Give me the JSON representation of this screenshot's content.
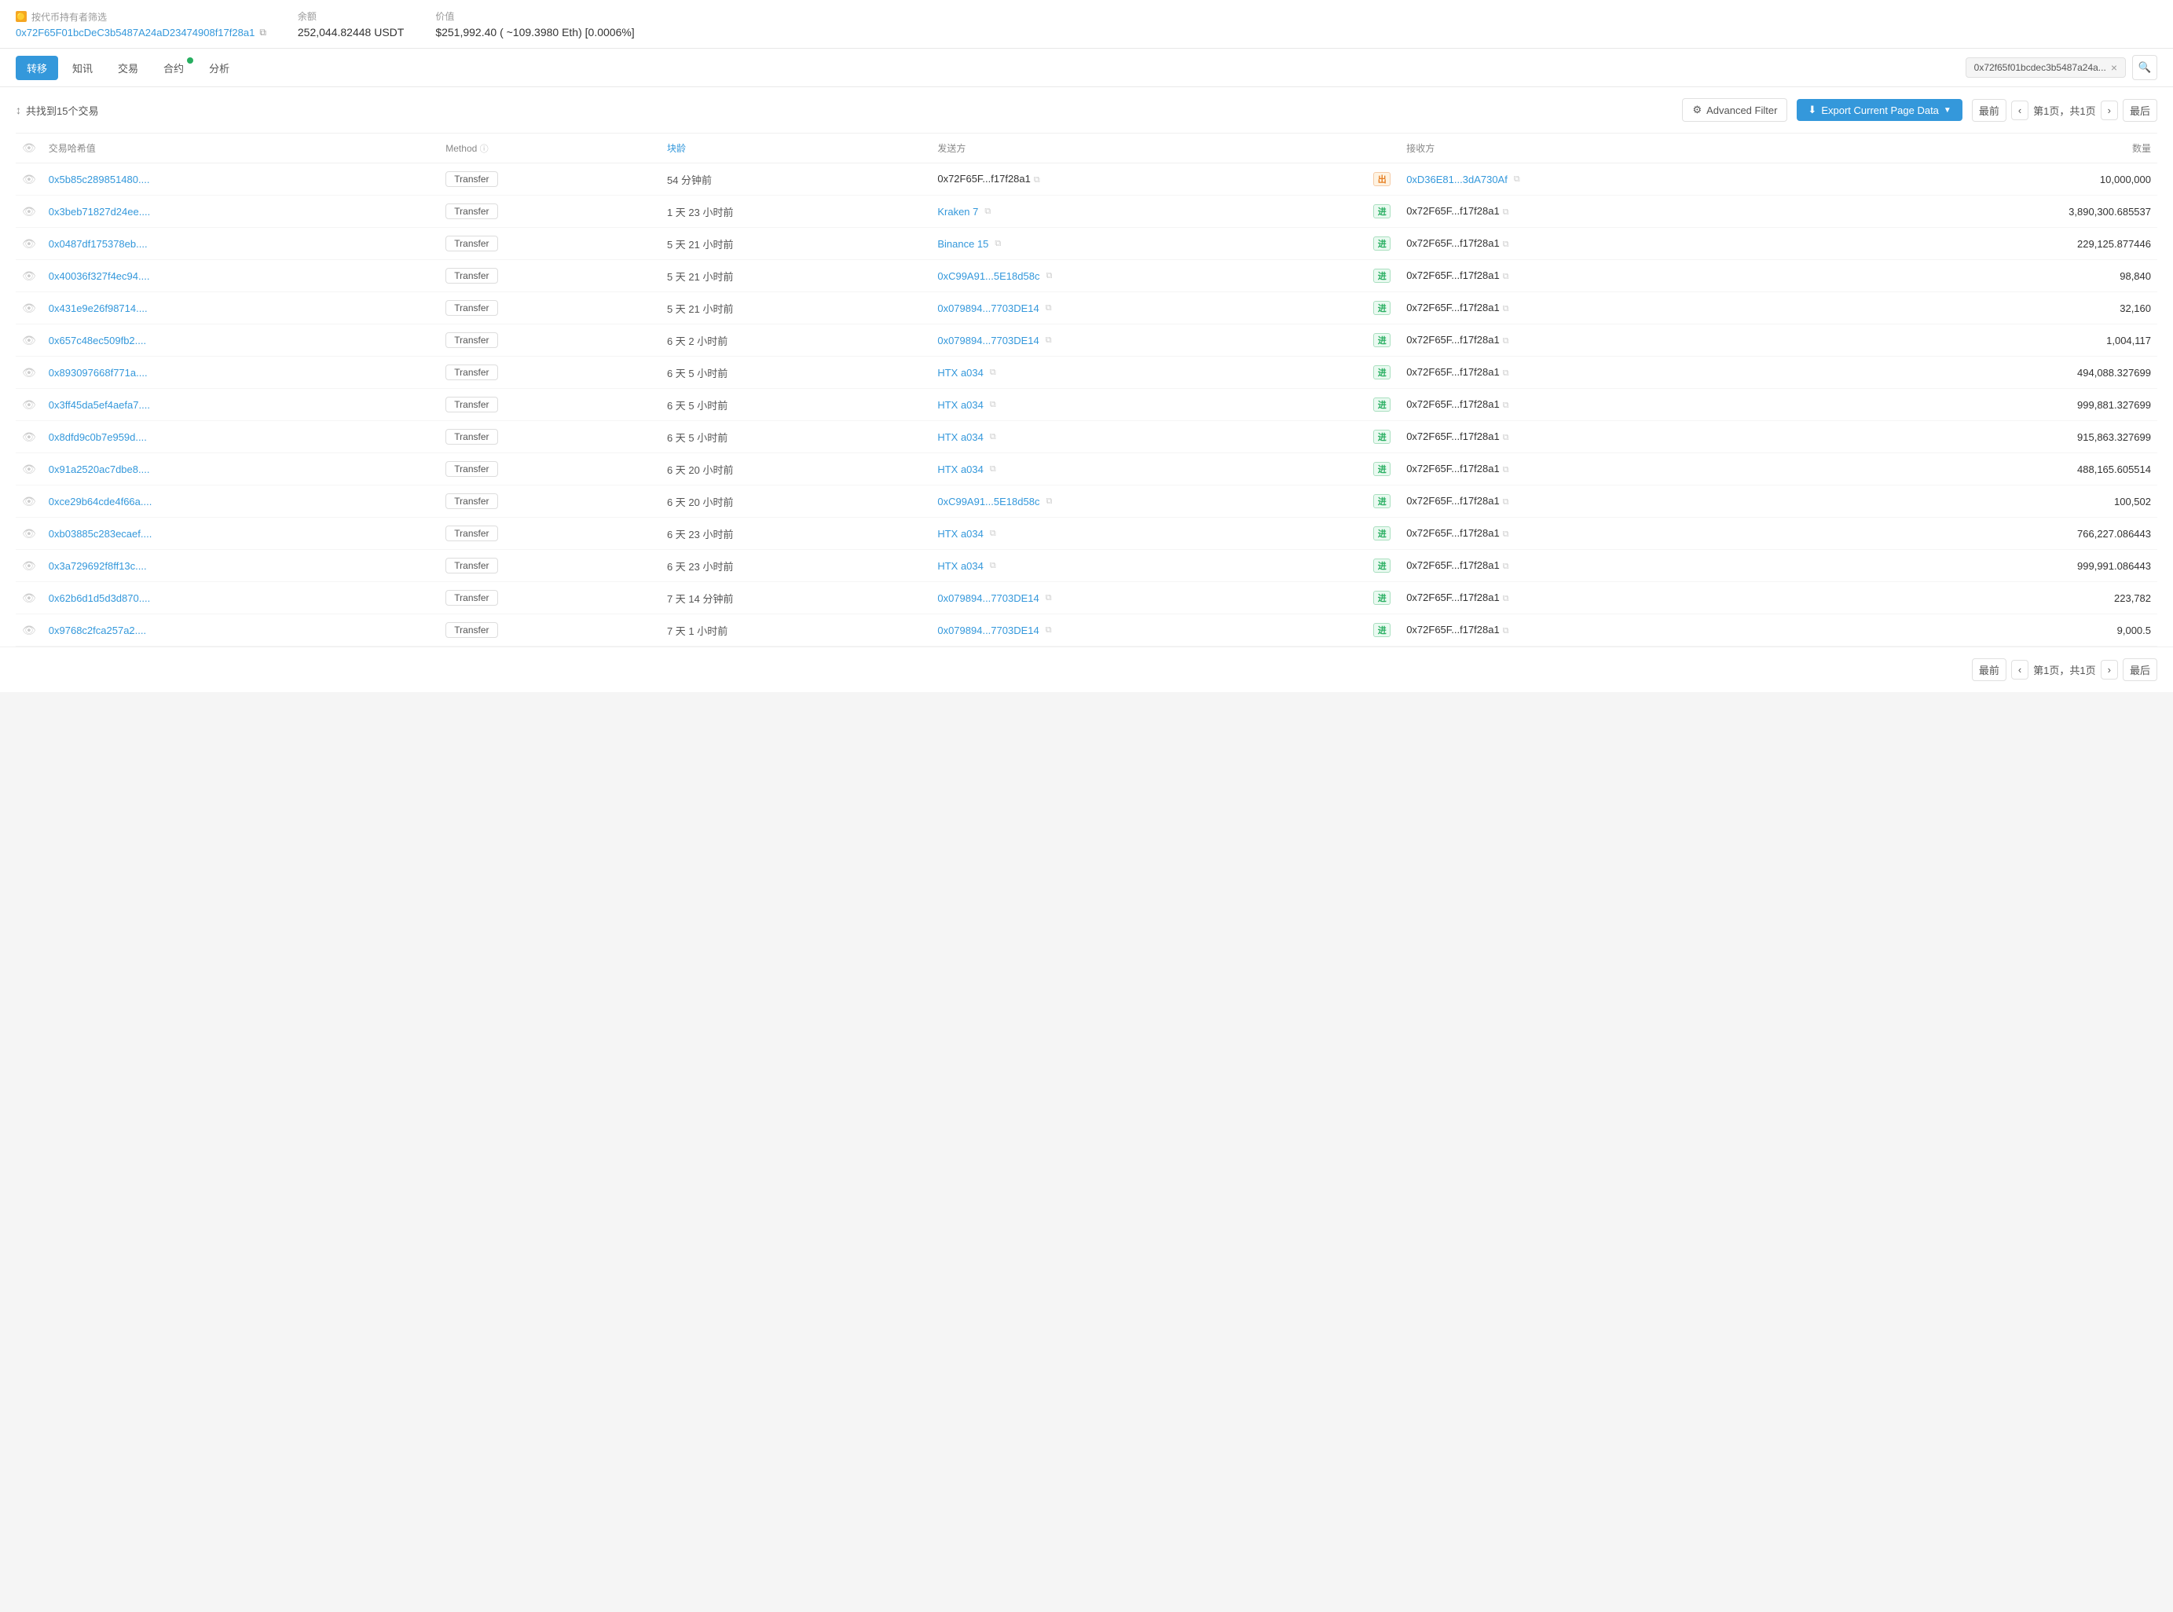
{
  "topbar": {
    "filter_label": "按代币持有者筛选",
    "filter_icon": "🟡",
    "address": "0x72F65F01bcDeC3b5487A24aD23474908f17f28a1",
    "copy_tooltip": "复制",
    "balance_label": "余额",
    "balance_value": "252,044.82448 USDT",
    "value_label": "价值",
    "value_value": "$251,992.40 ( ~109.3980 Eth) [0.0006%]"
  },
  "nav": {
    "tabs": [
      {
        "id": "transfer",
        "label": "转移",
        "active": true,
        "badge": false
      },
      {
        "id": "info",
        "label": "知讯",
        "active": false,
        "badge": false
      },
      {
        "id": "trade",
        "label": "交易",
        "active": false,
        "badge": false
      },
      {
        "id": "contract",
        "label": "合约",
        "active": false,
        "badge": true
      },
      {
        "id": "analysis",
        "label": "分析",
        "active": false,
        "badge": false
      }
    ],
    "address_pill": "0x72f65f01bcdec3b5487a24a...",
    "close_label": "×",
    "search_icon": "🔍"
  },
  "toolbar": {
    "sort_icon": "↕",
    "result_text": "共找到15个交易",
    "filter_btn_label": "Advanced Filter",
    "filter_icon": "⚙",
    "export_btn_label": "Export Current Page Data",
    "export_icon": "⬇",
    "first_label": "最前",
    "prev_icon": "‹",
    "page_info": "第1页，共1页",
    "next_icon": "›",
    "last_label": "最后"
  },
  "table": {
    "headers": [
      {
        "id": "watch",
        "label": ""
      },
      {
        "id": "txhash",
        "label": "交易哈希值"
      },
      {
        "id": "method",
        "label": "Method"
      },
      {
        "id": "block",
        "label": "块龄"
      },
      {
        "id": "from",
        "label": "发送方"
      },
      {
        "id": "arrow",
        "label": ""
      },
      {
        "id": "to",
        "label": "接收方"
      },
      {
        "id": "amount",
        "label": "数量"
      }
    ],
    "rows": [
      {
        "txhash": "0x5b85c289851480....",
        "method": "Transfer",
        "block": "54 分钟前",
        "from": "0x72F65F...f17f28a1",
        "from_link": false,
        "direction": "出",
        "direction_type": "out",
        "to": "0xD36E81...3dA730Af",
        "to_link": true,
        "amount": "10,000,000"
      },
      {
        "txhash": "0x3beb71827d24ee....",
        "method": "Transfer",
        "block": "1 天 23 小时前",
        "from": "Kraken 7",
        "from_link": true,
        "direction": "进",
        "direction_type": "in",
        "to": "0x72F65F...f17f28a1",
        "to_link": false,
        "amount": "3,890,300.685537"
      },
      {
        "txhash": "0x0487df175378eb....",
        "method": "Transfer",
        "block": "5 天 21 小时前",
        "from": "Binance 15",
        "from_link": true,
        "direction": "进",
        "direction_type": "in",
        "to": "0x72F65F...f17f28a1",
        "to_link": false,
        "amount": "229,125.877446"
      },
      {
        "txhash": "0x40036f327f4ec94....",
        "method": "Transfer",
        "block": "5 天 21 小时前",
        "from": "0xC99A91...5E18d58c",
        "from_link": true,
        "direction": "进",
        "direction_type": "in",
        "to": "0x72F65F...f17f28a1",
        "to_link": false,
        "amount": "98,840"
      },
      {
        "txhash": "0x431e9e26f98714....",
        "method": "Transfer",
        "block": "5 天 21 小时前",
        "from": "0x079894...7703DE14",
        "from_link": true,
        "direction": "进",
        "direction_type": "in",
        "to": "0x72F65F...f17f28a1",
        "to_link": false,
        "amount": "32,160"
      },
      {
        "txhash": "0x657c48ec509fb2....",
        "method": "Transfer",
        "block": "6 天 2 小时前",
        "from": "0x079894...7703DE14",
        "from_link": true,
        "direction": "进",
        "direction_type": "in",
        "to": "0x72F65F...f17f28a1",
        "to_link": false,
        "amount": "1,004,117"
      },
      {
        "txhash": "0x893097668f771a....",
        "method": "Transfer",
        "block": "6 天 5 小时前",
        "from": "HTX a034",
        "from_link": true,
        "direction": "进",
        "direction_type": "in",
        "to": "0x72F65F...f17f28a1",
        "to_link": false,
        "amount": "494,088.327699"
      },
      {
        "txhash": "0x3ff45da5ef4aefa7....",
        "method": "Transfer",
        "block": "6 天 5 小时前",
        "from": "HTX a034",
        "from_link": true,
        "direction": "进",
        "direction_type": "in",
        "to": "0x72F65F...f17f28a1",
        "to_link": false,
        "amount": "999,881.327699"
      },
      {
        "txhash": "0x8dfd9c0b7e959d....",
        "method": "Transfer",
        "block": "6 天 5 小时前",
        "from": "HTX a034",
        "from_link": true,
        "direction": "进",
        "direction_type": "in",
        "to": "0x72F65F...f17f28a1",
        "to_link": false,
        "amount": "915,863.327699"
      },
      {
        "txhash": "0x91a2520ac7dbe8....",
        "method": "Transfer",
        "block": "6 天 20 小时前",
        "from": "HTX a034",
        "from_link": true,
        "direction": "进",
        "direction_type": "in",
        "to": "0x72F65F...f17f28a1",
        "to_link": false,
        "amount": "488,165.605514"
      },
      {
        "txhash": "0xce29b64cde4f66a....",
        "method": "Transfer",
        "block": "6 天 20 小时前",
        "from": "0xC99A91...5E18d58c",
        "from_link": true,
        "direction": "进",
        "direction_type": "in",
        "to": "0x72F65F...f17f28a1",
        "to_link": false,
        "amount": "100,502"
      },
      {
        "txhash": "0xb03885c283ecaef....",
        "method": "Transfer",
        "block": "6 天 23 小时前",
        "from": "HTX a034",
        "from_link": true,
        "direction": "进",
        "direction_type": "in",
        "to": "0x72F65F...f17f28a1",
        "to_link": false,
        "amount": "766,227.086443"
      },
      {
        "txhash": "0x3a729692f8ff13c....",
        "method": "Transfer",
        "block": "6 天 23 小时前",
        "from": "HTX a034",
        "from_link": true,
        "direction": "进",
        "direction_type": "in",
        "to": "0x72F65F...f17f28a1",
        "to_link": false,
        "amount": "999,991.086443"
      },
      {
        "txhash": "0x62b6d1d5d3d870....",
        "method": "Transfer",
        "block": "7 天 14 分钟前",
        "from": "0x079894...7703DE14",
        "from_link": true,
        "direction": "进",
        "direction_type": "in",
        "to": "0x72F65F...f17f28a1",
        "to_link": false,
        "amount": "223,782"
      },
      {
        "txhash": "0x9768c2fca257a2....",
        "method": "Transfer",
        "block": "7 天 1 小时前",
        "from": "0x079894...7703DE14",
        "from_link": true,
        "direction": "进",
        "direction_type": "in",
        "to": "0x72F65F...f17f28a1",
        "to_link": false,
        "amount": "9,000.5"
      }
    ]
  },
  "pagination_bottom": {
    "first_label": "最前",
    "prev_icon": "‹",
    "page_info": "第1页，共1页",
    "next_icon": "›",
    "last_label": "最后"
  }
}
